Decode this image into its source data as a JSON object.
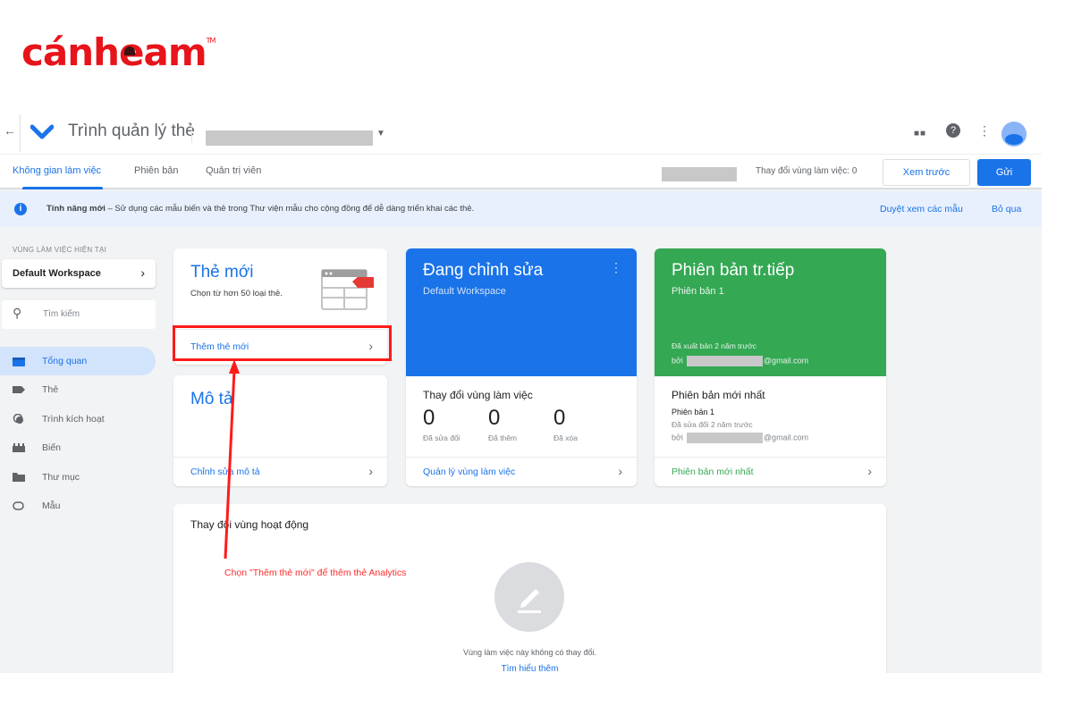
{
  "brand": {
    "logo_main": "cánh",
    "logo_e": "e",
    "logo_end": "am",
    "logo_tm": "TM",
    "color": "#e8141b"
  },
  "topbar": {
    "back_icon": "arrow-left-icon",
    "app_title": "Trình quản lý thẻ",
    "container_name": "",
    "apps_icon": "apps-grid-icon",
    "help_icon": "help-icon",
    "more_icon": "more-vert-icon"
  },
  "nav": {
    "tabs": [
      {
        "label": "Không gian làm việc",
        "active": true
      },
      {
        "label": "Phiên bản",
        "active": false
      },
      {
        "label": "Quản trị viên",
        "active": false
      }
    ],
    "workspace_changes": "Thay đổi vùng làm việc: 0",
    "preview_label": "Xem trước",
    "submit_label": "Gửi"
  },
  "banner": {
    "icon": "info-icon",
    "bold": "Tính năng mới",
    "text": " – Sử dụng các mẫu biến và thẻ trong Thư viện mẫu cho cộng đồng để dễ dàng triển khai các thẻ.",
    "browse_label": "Duyệt xem các mẫu",
    "dismiss_label": "Bỏ qua"
  },
  "sidebar": {
    "workspace_label": "VÙNG LÀM VIỆC HIỆN TẠI",
    "workspace_name": "Default Workspace",
    "search_placeholder": "Tìm kiếm",
    "items": [
      {
        "label": "Tổng quan",
        "icon": "overview-icon",
        "active": true
      },
      {
        "label": "Thẻ",
        "icon": "tag-icon",
        "active": false
      },
      {
        "label": "Trình kích hoạt",
        "icon": "trigger-icon",
        "active": false
      },
      {
        "label": "Biến",
        "icon": "variable-icon",
        "active": false
      },
      {
        "label": "Thư mục",
        "icon": "folder-icon",
        "active": false
      },
      {
        "label": "Mẫu",
        "icon": "template-icon",
        "active": false
      }
    ]
  },
  "cards": {
    "new_tag": {
      "title": "Thẻ mới",
      "subtitle": "Chọn từ hơn 50 loại thẻ.",
      "link": "Thêm thẻ mới"
    },
    "description": {
      "title": "Mô tả",
      "link": "Chỉnh sửa mô tả"
    },
    "editing": {
      "title": "Đang chỉnh sửa",
      "subtitle": "Default Workspace",
      "changes_title": "Thay đổi vùng làm việc",
      "stats": [
        {
          "value": "0",
          "label": "Đã sửa đổi"
        },
        {
          "value": "0",
          "label": "Đã thêm"
        },
        {
          "value": "0",
          "label": "Đã xóa"
        }
      ],
      "link": "Quản lý vùng làm việc",
      "color": "#1a73e8"
    },
    "live": {
      "title": "Phiên bản tr.tiếp",
      "subtitle": "Phiên bản 1",
      "published": "Đã xuất bản 2 năm trước",
      "by_prefix": "bởi",
      "email_suffix": "@gmail.com",
      "latest_title": "Phiên bản mới nhất",
      "latest_version": "Phiên bản 1",
      "latest_modified": "Đã sửa đổi 2 năm trước",
      "link": "Phiên bản mới nhất",
      "color": "#34a853"
    },
    "activity": {
      "title": "Thay đổi vùng hoạt động",
      "empty_text": "Vùng làm việc này không có thay đổi.",
      "learn_more": "Tìm hiểu thêm"
    }
  },
  "annotation": {
    "text": "Chọn \"Thêm thẻ mới\" để thêm thẻ Analytics",
    "color": "#ff1a1a"
  }
}
